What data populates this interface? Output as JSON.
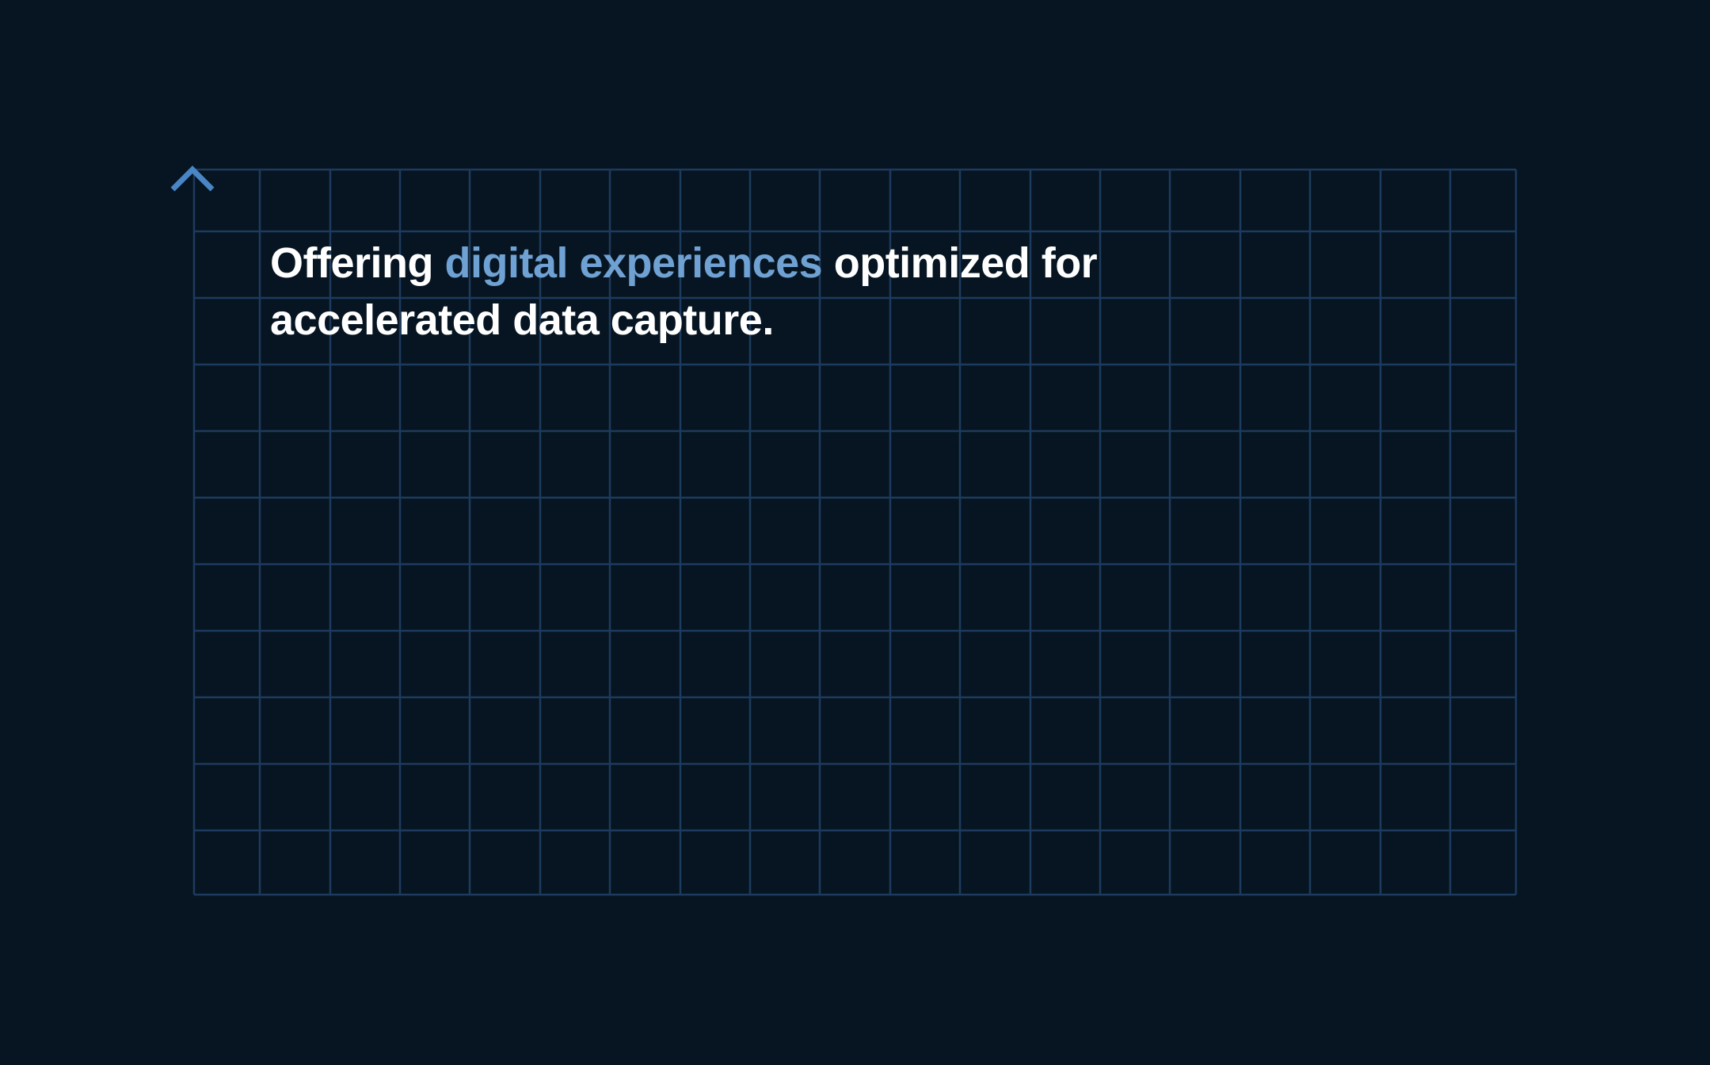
{
  "headline": {
    "part1": "Offering ",
    "highlight": "digital experiences",
    "part2": " optimized for",
    "line2": "accelerated data capture."
  },
  "colors": {
    "background": "#061521",
    "grid": "#1d3b5e",
    "accent": "#6fa1d3",
    "arrow": "#4a86c5",
    "text": "#ffffff"
  },
  "icons": {
    "axis_arrow": "up-arrow-icon"
  }
}
